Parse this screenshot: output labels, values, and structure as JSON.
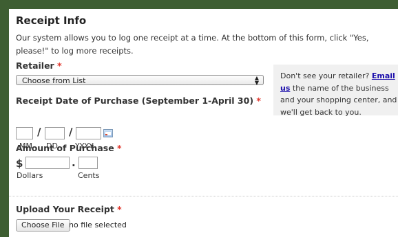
{
  "form": {
    "title": "Receipt Info",
    "intro": "Our system allows you to log one receipt at a time. At the bottom of this form, click \"Yes, please!\" to log more receipts.",
    "required_mark": "*",
    "retailer": {
      "label": "Retailer",
      "selected": "Choose from List"
    },
    "date": {
      "label": "Receipt Date of Purchase (September 1-April 30)",
      "separator": "/",
      "month_label": "MM",
      "day_label": "DD",
      "year_label": "YYYY",
      "month_value": "",
      "day_value": "",
      "year_value": ""
    },
    "amount": {
      "label": "Amount of Purchase",
      "currency": "$",
      "decimal": ".",
      "dollars_label": "Dollars",
      "cents_label": "Cents",
      "dollars_value": "",
      "cents_value": ""
    },
    "upload": {
      "label": "Upload Your Receipt",
      "button": "Choose File",
      "status": "no file selected"
    }
  },
  "sidebar": {
    "text_before": "Don't see your retailer?",
    "link": "Email us",
    "text_after": "the name of the business and your shopping center, and we'll get back to you."
  },
  "colors": {
    "frame": "#3e5e32",
    "required": "#e0352b",
    "link": "#1a0dab"
  }
}
